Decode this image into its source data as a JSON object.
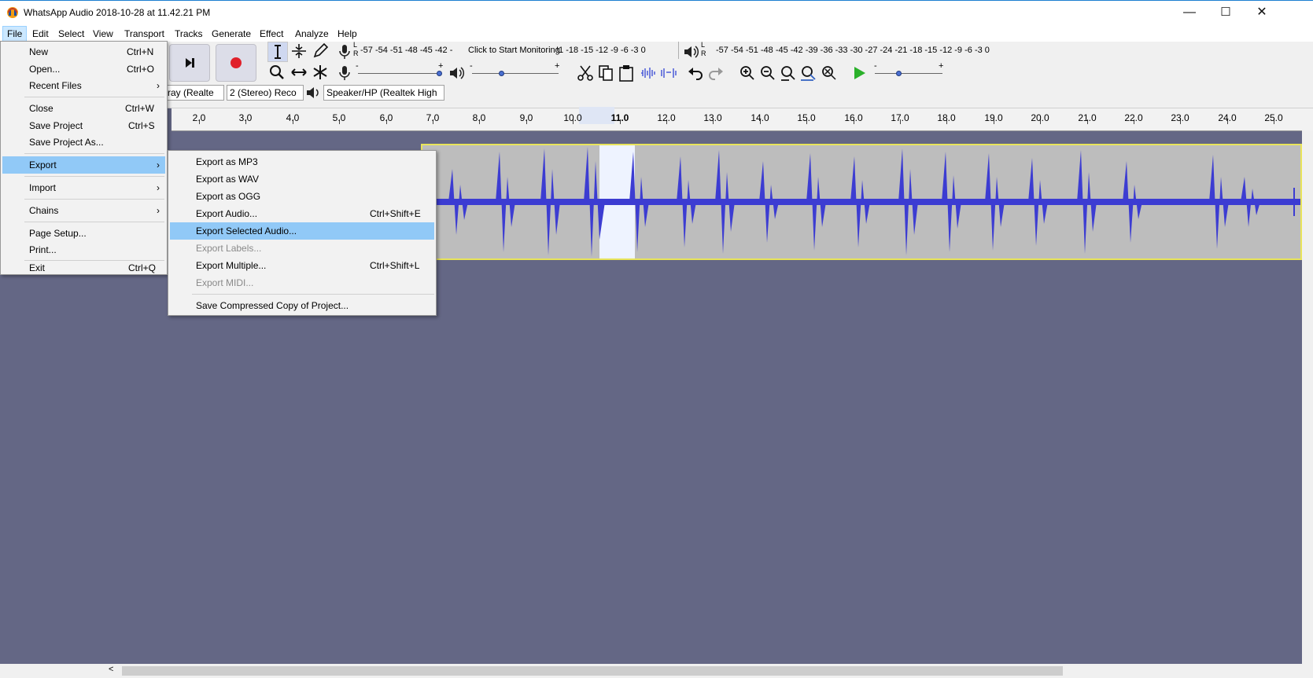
{
  "window": {
    "title": "WhatsApp Audio 2018-10-28 at 11.42.21 PM",
    "minimize": "—",
    "maximize": "☐",
    "close": "✕"
  },
  "menubar": [
    "File",
    "Edit",
    "Select",
    "View",
    "Transport",
    "Tracks",
    "Generate",
    "Effect",
    "Analyze",
    "Help"
  ],
  "file_menu": {
    "items": [
      {
        "label": "New",
        "shortcut": "Ctrl+N"
      },
      {
        "label": "Open...",
        "shortcut": "Ctrl+O"
      },
      {
        "label": "Recent Files",
        "submenu": true
      },
      {
        "label": "Close",
        "shortcut": "Ctrl+W"
      },
      {
        "label": "Save Project",
        "shortcut": "Ctrl+S"
      },
      {
        "label": "Save Project As...",
        "shortcut": ""
      },
      {
        "label": "Export",
        "submenu": true
      },
      {
        "label": "Import",
        "submenu": true
      },
      {
        "label": "Chains",
        "submenu": true
      },
      {
        "label": "Page Setup...",
        "shortcut": ""
      },
      {
        "label": "Print...",
        "shortcut": ""
      },
      {
        "label": "Exit",
        "shortcut": "Ctrl+Q"
      }
    ]
  },
  "export_menu": {
    "items": [
      {
        "label": "Export as MP3",
        "shortcut": ""
      },
      {
        "label": "Export as WAV",
        "shortcut": ""
      },
      {
        "label": "Export as OGG",
        "shortcut": ""
      },
      {
        "label": "Export Audio...",
        "shortcut": "Ctrl+Shift+E"
      },
      {
        "label": "Export Selected Audio...",
        "shortcut": ""
      },
      {
        "label": "Export Labels...",
        "shortcut": "",
        "disabled": true
      },
      {
        "label": "Export Multiple...",
        "shortcut": "Ctrl+Shift+L"
      },
      {
        "label": "Export MIDI...",
        "shortcut": "",
        "disabled": true
      },
      {
        "label": "Save Compressed Copy of Project...",
        "shortcut": ""
      }
    ]
  },
  "toolbar": {
    "rec_meter_scale": "-57 -54 -51 -48 -45 -42 -",
    "monitor_text": "Click to Start Monitoring",
    "rec_meter_scale2": "!1 -18 -15 -12  -9  -6  -3  0",
    "play_meter_scale": "-57 -54 -51 -48 -45 -42 -39 -36 -33 -30 -27 -24 -21 -18 -15 -12  -9  -6  -3  0",
    "lr_L": "L",
    "lr_R": "R",
    "slider_minus": "-",
    "slider_plus": "+",
    "input_device": "rray (Realte",
    "channels": "2 (Stereo) Reco",
    "output_device": "Speaker/HP (Realtek High"
  },
  "ruler": {
    "labels": [
      "2.0",
      "3.0",
      "4.0",
      "5.0",
      "6.0",
      "7.0",
      "8.0",
      "9.0",
      "10.0",
      "11.0",
      "12.0",
      "13.0",
      "14.0",
      "15.0",
      "16.0",
      "17.0",
      "18.0",
      "19.0",
      "20.0",
      "21.0",
      "22.0",
      "23.0",
      "24.0",
      "25.0"
    ]
  },
  "colors": {
    "waveform": "#3c3cd2",
    "highlight": "#91c9f7",
    "workspace": "#646785"
  },
  "icons": {
    "skip_end": "skip-end-icon",
    "record": "record-icon"
  }
}
